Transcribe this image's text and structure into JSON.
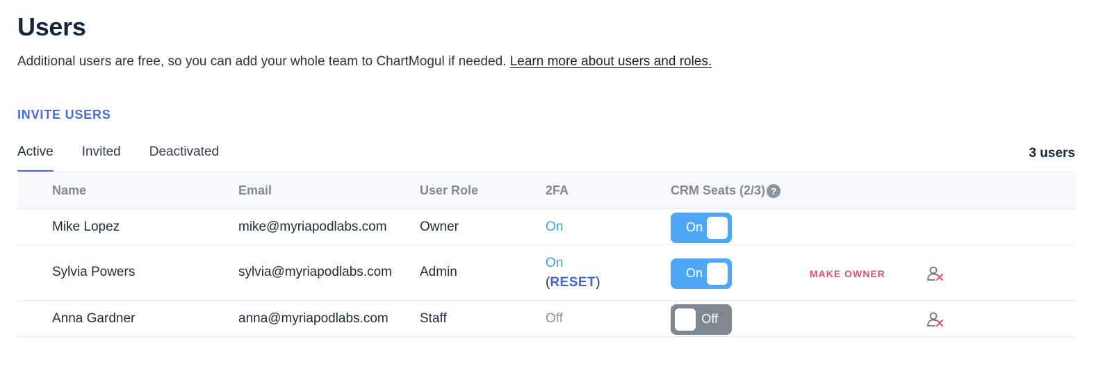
{
  "page": {
    "title": "Users",
    "intro_text": "Additional users are free, so you can add your whole team to ChartMogul if needed.",
    "intro_link": "Learn more about users and roles."
  },
  "invite_label": "INVITE USERS",
  "tabs": [
    {
      "label": "Active",
      "active": true
    },
    {
      "label": "Invited",
      "active": false
    },
    {
      "label": "Deactivated",
      "active": false
    }
  ],
  "user_count": "3 users",
  "table": {
    "columns": {
      "name": "Name",
      "email": "Email",
      "role": "User Role",
      "tfa": "2FA",
      "crm": "CRM Seats (2/3)"
    },
    "help_icon": "question-circle-icon",
    "rows": [
      {
        "name": "Mike Lopez",
        "email": "mike@myriapodlabs.com",
        "role": "Owner",
        "tfa": "On",
        "crm": "On"
      },
      {
        "name": "Sylvia Powers",
        "email": "sylvia@myriapodlabs.com",
        "role": "Admin",
        "tfa": "On",
        "tfa_reset": "RESET",
        "crm": "On",
        "action": "MAKE OWNER",
        "remove_icon": "remove-user-icon"
      },
      {
        "name": "Anna Gardner",
        "email": "anna@myriapodlabs.com",
        "role": "Staff",
        "tfa": "Off",
        "crm": "Off",
        "remove_icon": "remove-user-icon"
      }
    ]
  },
  "colors": {
    "accent": "#4a6cd9",
    "toggle_on": "#4ea7f4",
    "toggle_off": "#7f8891",
    "danger": "#e0506d",
    "tfa_on": "#3b9ff0"
  }
}
